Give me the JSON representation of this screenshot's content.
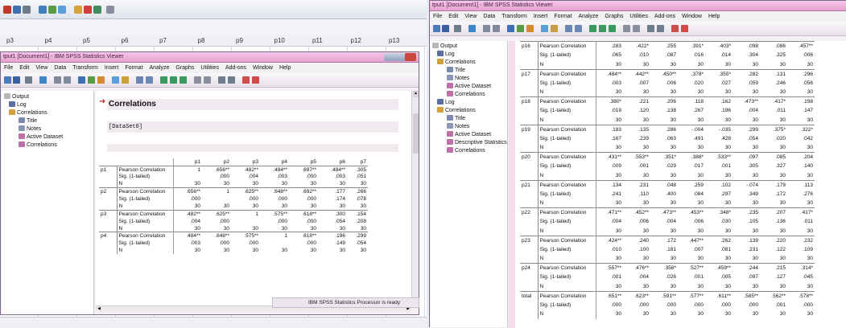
{
  "bg_editor": {
    "columns": [
      "p3",
      "p4",
      "p5",
      "p6",
      "p7",
      "p8",
      "p9",
      "p10",
      "p11",
      "p12",
      "p13"
    ]
  },
  "left_window": {
    "title": "tput1 [Document1] - IBM SPSS Statistics Viewer",
    "menu": [
      "File",
      "Edit",
      "View",
      "Data",
      "Transform",
      "Insert",
      "Format",
      "Analyze",
      "Graphs",
      "Utilities",
      "Add-ons",
      "Window",
      "Help"
    ],
    "tree": [
      "Output",
      "Log",
      "Correlations",
      "Title",
      "Notes",
      "Active Dataset",
      "Correlations"
    ],
    "heading": "Correlations",
    "dataset": "[DataSet0]",
    "status": "IBM SPSS Statistics Processor is ready",
    "table": {
      "headers": [
        "",
        "",
        "p1",
        "p2",
        "p3",
        "p4",
        "p5",
        "p6",
        "p7"
      ],
      "rows": [
        [
          "p1",
          "Pearson Correlation",
          "1",
          ".656**",
          ".482**",
          ".484**",
          ".697**",
          ".484**",
          ".305"
        ],
        [
          "",
          "Sig. (1-tailed)",
          "",
          ".000",
          ".004",
          ".003",
          ".000",
          ".003",
          ".051"
        ],
        [
          "",
          "N",
          "30",
          "30",
          "30",
          "30",
          "30",
          "30",
          "30"
        ],
        [
          "p2",
          "Pearson Correlation",
          ".656**",
          "1",
          ".625**",
          ".648**",
          ".692**",
          ".177",
          ".266"
        ],
        [
          "",
          "Sig. (1-tailed)",
          ".000",
          "",
          ".000",
          ".000",
          ".000",
          ".174",
          ".078"
        ],
        [
          "",
          "N",
          "30",
          "30",
          "30",
          "30",
          "30",
          "30",
          "30"
        ],
        [
          "p3",
          "Pearson Correlation",
          ".482**",
          ".625**",
          "1",
          ".575**",
          ".618**",
          ".300",
          ".154"
        ],
        [
          "",
          "Sig. (1-tailed)",
          ".004",
          ".000",
          "",
          ".000",
          ".000",
          ".054",
          ".208"
        ],
        [
          "",
          "N",
          "30",
          "30",
          "30",
          "30",
          "30",
          "30",
          "30"
        ],
        [
          "p4",
          "Pearson Correlation",
          ".484**",
          ".648**",
          ".575**",
          "1",
          ".618**",
          ".196",
          ".299"
        ],
        [
          "",
          "Sig. (1-tailed)",
          ".003",
          ".000",
          ".000",
          "",
          ".000",
          ".149",
          ".054"
        ],
        [
          "",
          "N",
          "30",
          "30",
          "30",
          "30",
          "30",
          "30",
          "30"
        ]
      ]
    }
  },
  "right_window": {
    "title": "tput1 [Document1] - IBM SPSS Statistics Viewer",
    "menu": [
      "File",
      "Edit",
      "View",
      "Data",
      "Transform",
      "Insert",
      "Format",
      "Analyze",
      "Graphs",
      "Utilities",
      "Add-ons",
      "Window",
      "Help"
    ],
    "tree": [
      "Output",
      "Log",
      "Correlations",
      "Title",
      "Notes",
      "Active Dataset",
      "Correlations",
      "Log",
      "Correlations",
      "Title",
      "Notes",
      "Active Dataset",
      "Descriptive Statistics",
      "Correlations"
    ],
    "table": {
      "rows": [
        [
          "p16",
          "Pearson Correlation",
          ".283",
          ".422*",
          ".255",
          ".391*",
          ".403*",
          ".098",
          ".086",
          ".457**"
        ],
        [
          "",
          "Sig. (1-tailed)",
          ".065",
          ".010",
          ".087",
          ".016",
          ".014",
          ".304",
          ".325",
          ".006"
        ],
        [
          "",
          "N",
          "30",
          "30",
          "30",
          "30",
          "30",
          "30",
          "30",
          "30"
        ],
        [
          "p17",
          "Pearson Correlation",
          ".484**",
          ".442**",
          ".450**",
          ".378*",
          ".355*",
          ".282",
          ".131",
          ".296"
        ],
        [
          "",
          "Sig. (1-tailed)",
          ".003",
          ".007",
          ".006",
          ".020",
          ".027",
          ".059",
          ".246",
          ".056"
        ],
        [
          "",
          "N",
          "30",
          "30",
          "30",
          "30",
          "30",
          "30",
          "30",
          "30"
        ],
        [
          "p18",
          "Pearson Correlation",
          ".380*",
          ".221",
          ".206",
          ".118",
          ".162",
          ".473**",
          ".417*",
          ".198"
        ],
        [
          "",
          "Sig. (1-tailed)",
          ".019",
          ".120",
          ".138",
          ".267",
          ".196",
          ".004",
          ".011",
          ".147"
        ],
        [
          "",
          "N",
          "30",
          "30",
          "30",
          "30",
          "30",
          "30",
          "30",
          "30"
        ],
        [
          "p19",
          "Pearson Correlation",
          ".183",
          ".135",
          ".286",
          "-.004",
          "-.035",
          ".299",
          ".375*",
          ".322*"
        ],
        [
          "",
          "Sig. (1-tailed)",
          ".167",
          ".239",
          ".063",
          ".491",
          ".428",
          ".054",
          ".020",
          ".042"
        ],
        [
          "",
          "N",
          "30",
          "30",
          "30",
          "30",
          "30",
          "30",
          "30",
          "30"
        ],
        [
          "p20",
          "Pearson Correlation",
          ".431**",
          ".553**",
          ".351*",
          ".388*",
          ".533**",
          ".097",
          ".085",
          ".204"
        ],
        [
          "",
          "Sig. (1-tailed)",
          ".009",
          ".001",
          ".029",
          ".017",
          ".001",
          ".305",
          ".327",
          ".140"
        ],
        [
          "",
          "N",
          "30",
          "30",
          "30",
          "30",
          "30",
          "30",
          "30",
          "30"
        ],
        [
          "p21",
          "Pearson Correlation",
          ".134",
          ".231",
          ".048",
          ".259",
          ".102",
          "-.074",
          ".179",
          ".113"
        ],
        [
          "",
          "Sig. (1-tailed)",
          ".241",
          ".110",
          ".400",
          ".084",
          ".297",
          ".349",
          ".172",
          ".276"
        ],
        [
          "",
          "N",
          "30",
          "30",
          "30",
          "30",
          "30",
          "30",
          "30",
          "30"
        ],
        [
          "p22",
          "Pearson Correlation",
          ".471**",
          ".452**",
          ".473**",
          ".453**",
          ".348*",
          ".235",
          ".207",
          ".417*"
        ],
        [
          "",
          "Sig. (1-tailed)",
          ".004",
          ".006",
          ".004",
          ".006",
          ".030",
          ".105",
          ".136",
          ".011"
        ],
        [
          "",
          "N",
          "30",
          "30",
          "30",
          "30",
          "30",
          "30",
          "30",
          "30"
        ],
        [
          "p23",
          "Pearson Correlation",
          ".424**",
          ".240",
          ".172",
          ".447**",
          ".262",
          ".139",
          ".220",
          ".232"
        ],
        [
          "",
          "Sig. (1-tailed)",
          ".010",
          ".100",
          ".181",
          ".007",
          ".081",
          ".231",
          ".122",
          ".109"
        ],
        [
          "",
          "N",
          "30",
          "30",
          "30",
          "30",
          "30",
          "30",
          "30",
          "30"
        ],
        [
          "p24",
          "Pearson Correlation",
          ".557**",
          ".476**",
          ".358*",
          ".527**",
          ".459**",
          ".244",
          ".215",
          ".314*"
        ],
        [
          "",
          "Sig. (1-tailed)",
          ".001",
          ".004",
          ".026",
          ".001",
          ".005",
          ".097",
          ".127",
          ".045"
        ],
        [
          "",
          "N",
          "30",
          "30",
          "30",
          "30",
          "30",
          "30",
          "30",
          "30"
        ],
        [
          "total",
          "Pearson Correlation",
          ".651**",
          ".623**",
          ".591**",
          ".577**",
          ".611**",
          ".585**",
          ".562**",
          ".578**"
        ],
        [
          "",
          "Sig. (1-tailed)",
          ".000",
          ".000",
          ".000",
          ".000",
          ".000",
          ".000",
          ".001",
          ".000"
        ],
        [
          "",
          "N",
          "30",
          "30",
          "30",
          "30",
          "30",
          "30",
          "30",
          "30"
        ]
      ]
    }
  }
}
